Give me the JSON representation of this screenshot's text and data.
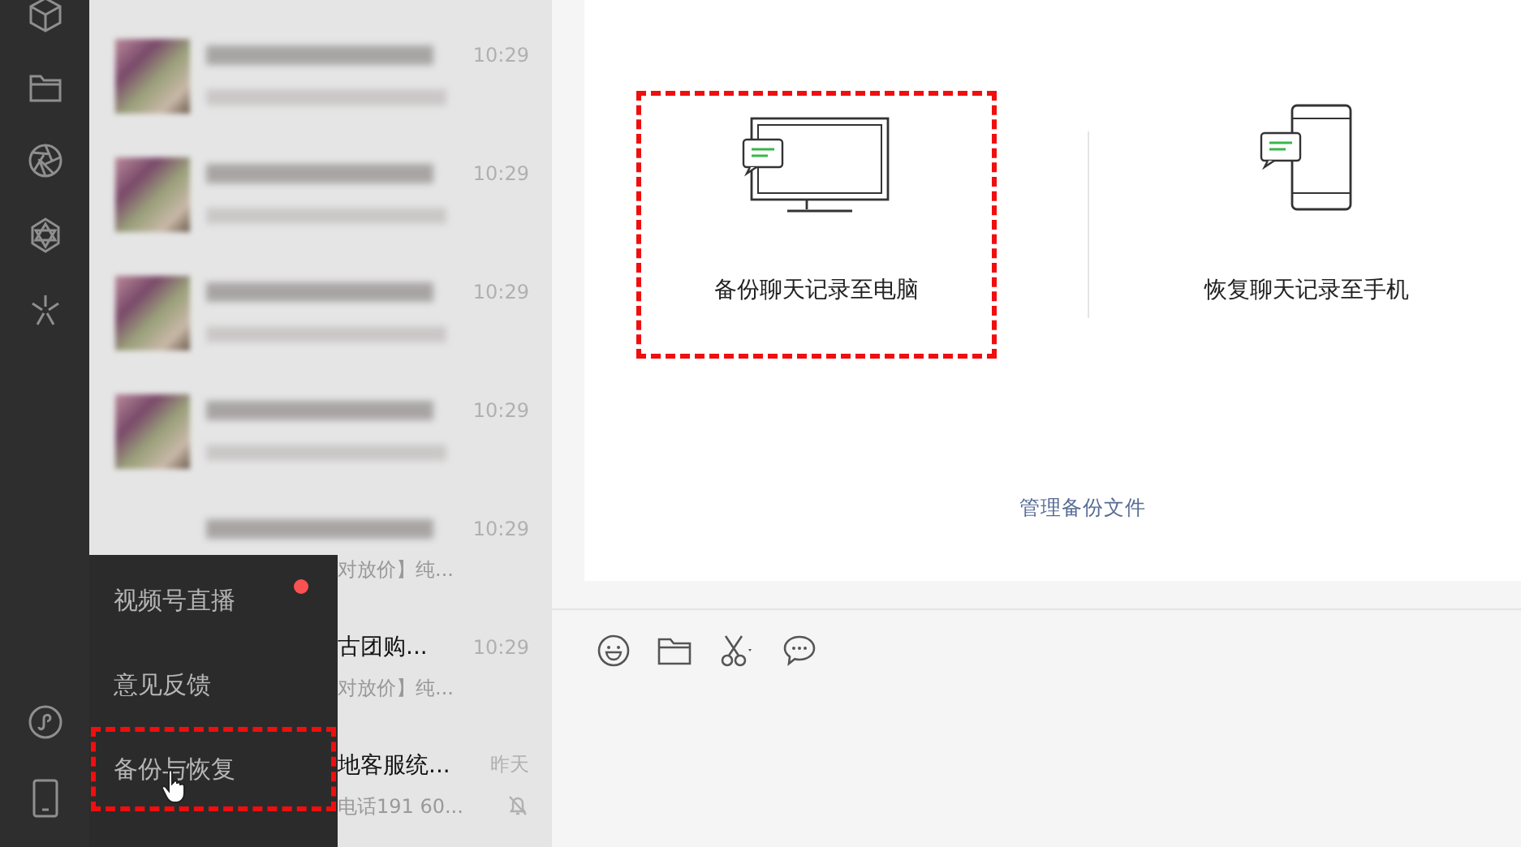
{
  "chats": [
    {
      "kind": "blurred",
      "time": "10:29",
      "covered": false,
      "muted": false
    },
    {
      "kind": "blurred",
      "time": "10:29",
      "covered": false,
      "muted": false
    },
    {
      "kind": "blurred",
      "time": "10:29",
      "covered": false,
      "muted": false
    },
    {
      "kind": "blurred",
      "time": "10:29",
      "covered": false,
      "muted": false
    },
    {
      "kind": "blurred",
      "time": "10:29",
      "preview": "对放价】纯...",
      "covered": true,
      "muted": false
    },
    {
      "kind": "text",
      "title": "古团购...",
      "time": "10:29",
      "preview": "对放价】纯...",
      "covered": true,
      "muted": false
    },
    {
      "kind": "text",
      "title": "地客服统...",
      "time": "昨天",
      "preview": "电话191 60...",
      "covered": true,
      "muted": true
    }
  ],
  "menu": {
    "items": [
      {
        "label": "视频号直播",
        "unread": true,
        "highlighted": false
      },
      {
        "label": "意见反馈",
        "unread": false,
        "highlighted": false
      },
      {
        "label": "备份与恢复",
        "unread": false,
        "highlighted": true
      }
    ]
  },
  "backup": {
    "options": [
      {
        "kind": "computer",
        "label": "备份聊天记录至电脑",
        "highlighted": true
      },
      {
        "kind": "phone",
        "label": "恢复聊天记录至手机",
        "highlighted": false
      }
    ],
    "manage_link": "管理备份文件"
  }
}
